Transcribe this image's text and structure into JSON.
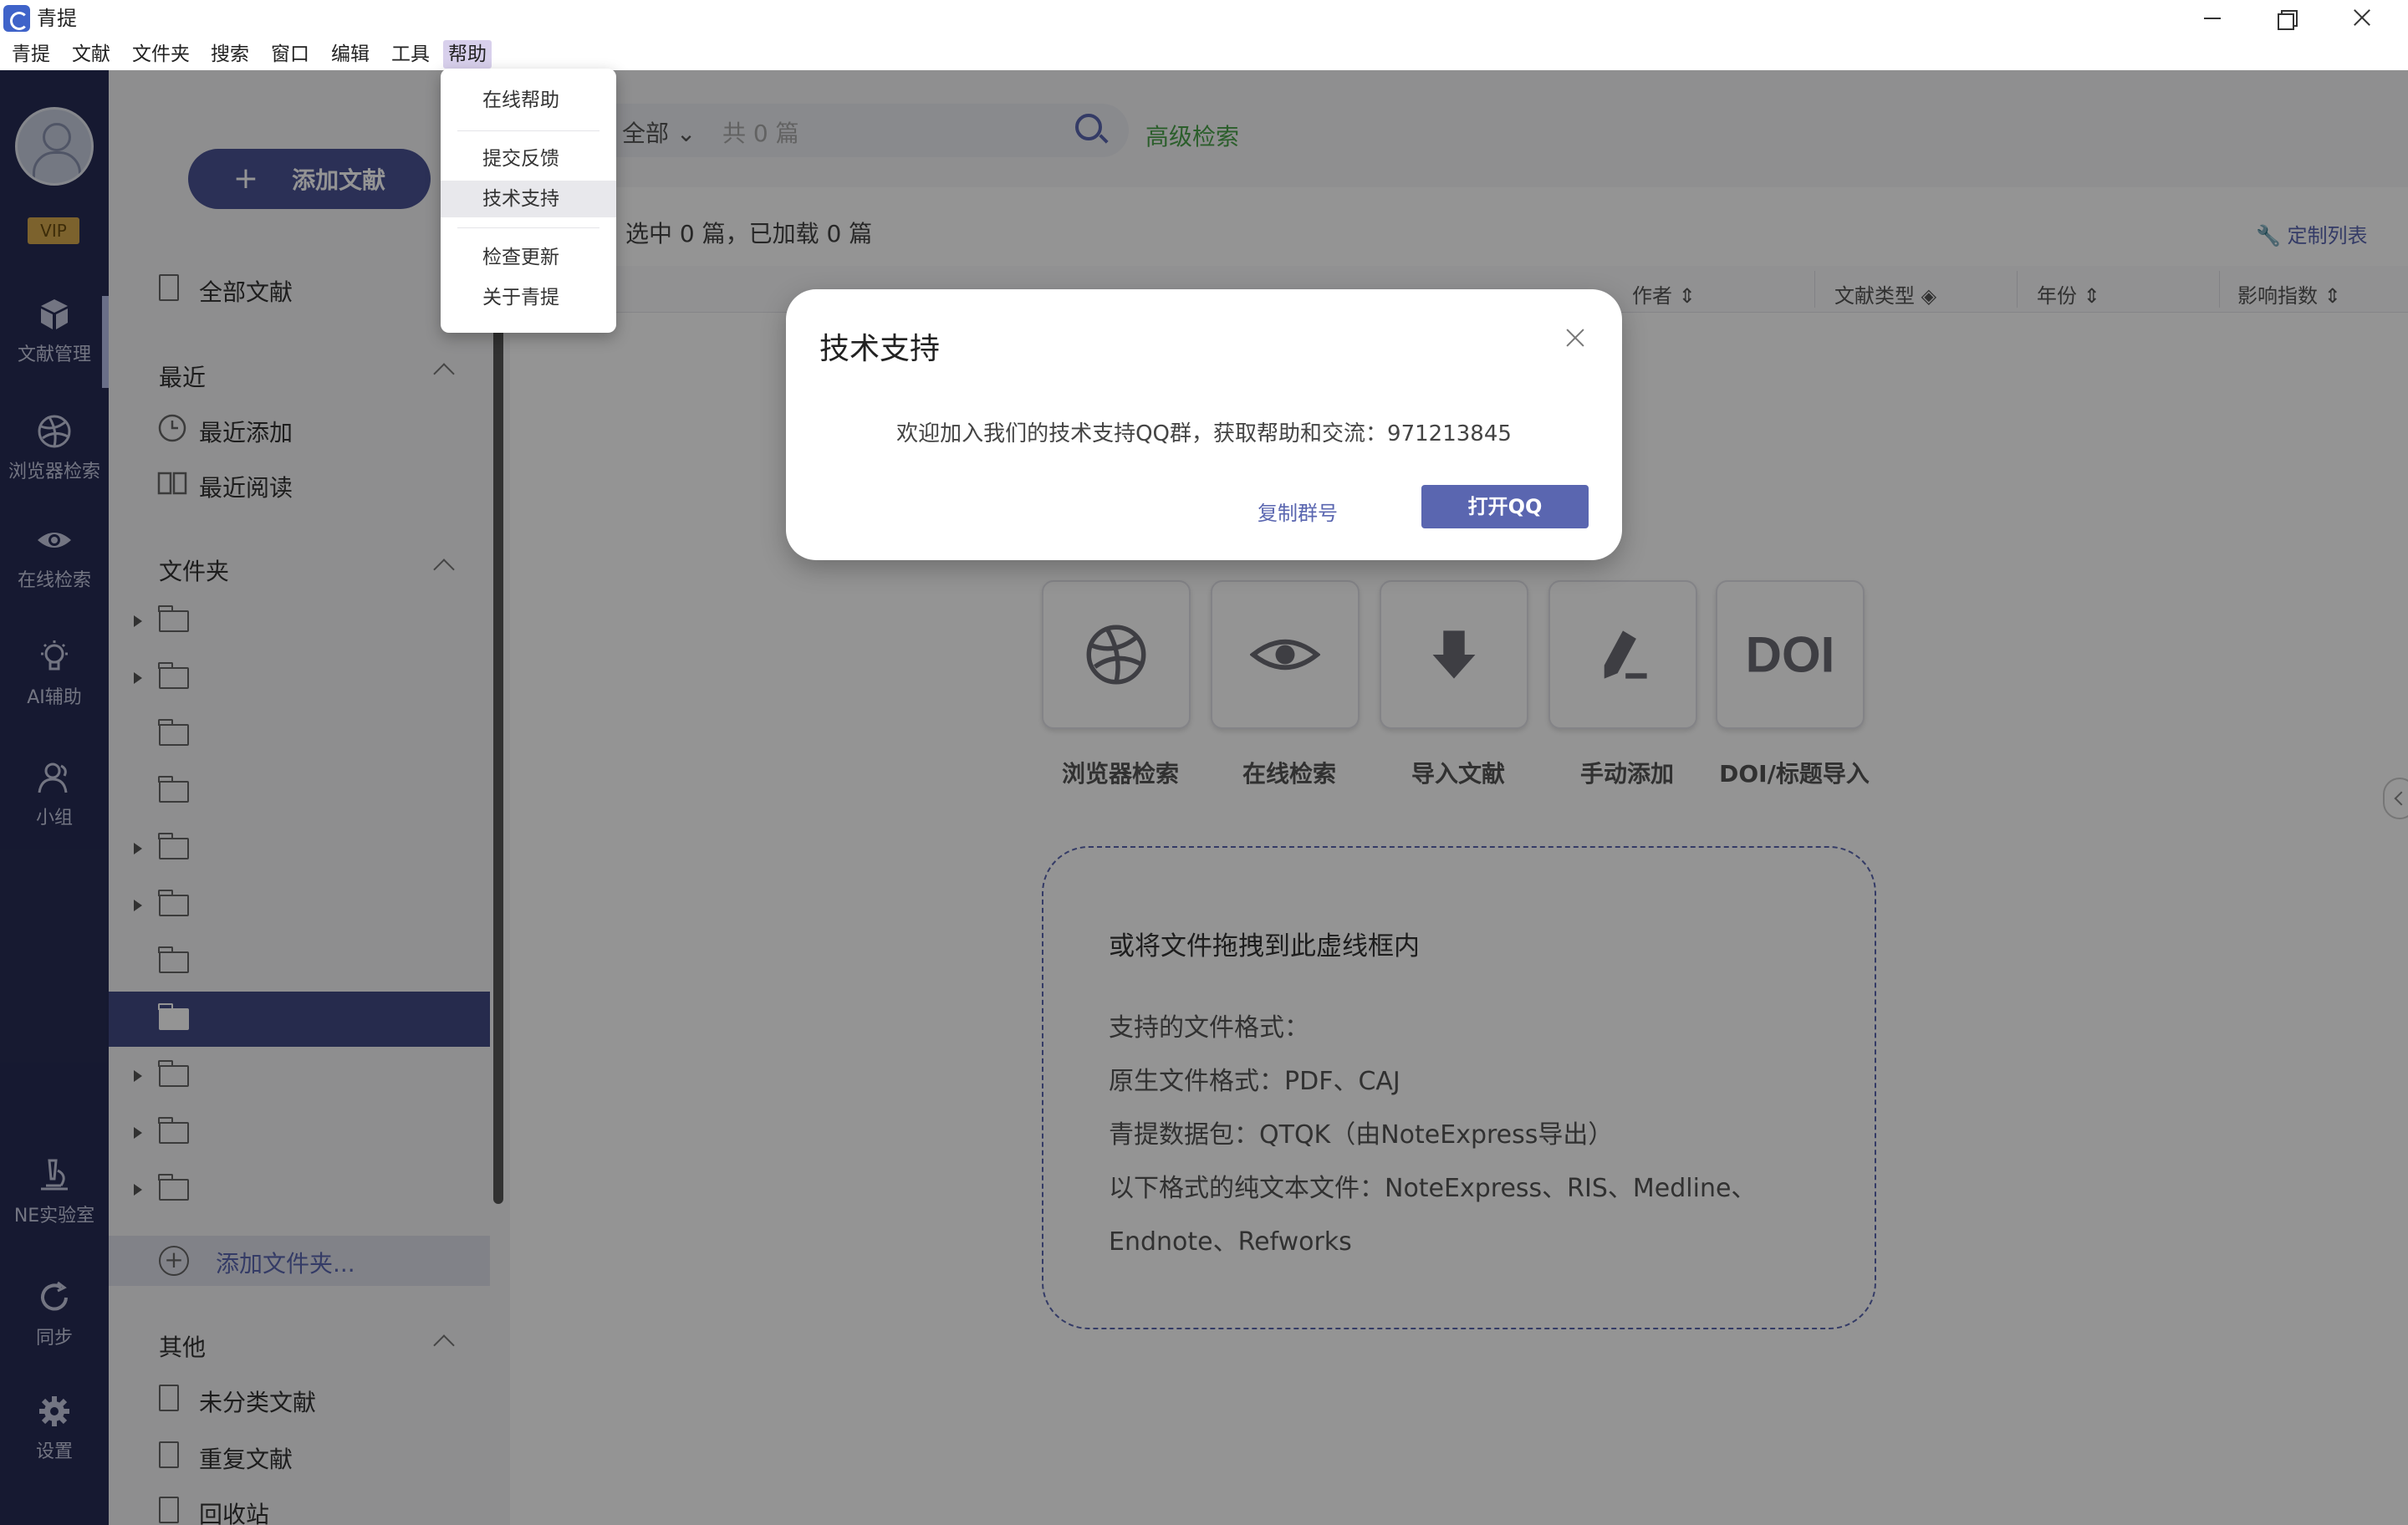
{
  "window": {
    "title": "青提"
  },
  "menubar": {
    "items": [
      {
        "label": "青提"
      },
      {
        "label": "文献"
      },
      {
        "label": "文件夹"
      },
      {
        "label": "搜索"
      },
      {
        "label": "窗口"
      },
      {
        "label": "编辑"
      },
      {
        "label": "工具"
      },
      {
        "label": "帮助"
      }
    ],
    "active": "帮助"
  },
  "rail": {
    "vip": "VIP",
    "items": [
      {
        "label": "文献管理",
        "icon": "cube-icon"
      },
      {
        "label": "浏览器检索",
        "icon": "basketball-icon"
      },
      {
        "label": "在线检索",
        "icon": "eye-icon"
      },
      {
        "label": "AI辅助",
        "icon": "lightbulb-icon"
      },
      {
        "label": "小组",
        "icon": "group-icon"
      },
      {
        "label": "NE实验室",
        "icon": "microscope-icon"
      },
      {
        "label": "同步",
        "icon": "sync-icon"
      },
      {
        "label": "设置",
        "icon": "gear-icon"
      }
    ]
  },
  "sidebar": {
    "add_button": "添加文献",
    "all_docs": "全部文献",
    "recent": {
      "title": "最近",
      "items": [
        "最近添加",
        "最近阅读"
      ]
    },
    "folders": {
      "title": "文件夹",
      "add_label": "添加文件夹..."
    },
    "other": {
      "title": "其他",
      "items": [
        "未分类文献",
        "重复文献",
        "回收站"
      ]
    }
  },
  "main": {
    "search": {
      "scope": "全部",
      "count": "共 0 篇",
      "advanced": "高级检索"
    },
    "selection_info": "选中 0 篇，已加载 0 篇",
    "customize": "定制列表",
    "columns": [
      "作者",
      "文献类型",
      "年份",
      "影响指数"
    ],
    "quick_actions": [
      "浏览器检索",
      "在线检索",
      "导入文献",
      "手动添加",
      "DOI/标题导入"
    ],
    "doi_text": "DOI",
    "drop_zone": {
      "title": "或将文件拖拽到此虚线框内",
      "lines": [
        "支持的文件格式：",
        "原生文件格式：PDF、CAJ",
        "青提数据包：QTQK（由NoteExpress导出）",
        "以下格式的纯文本文件：NoteExpress、RIS、Medline、",
        "Endnote、Refworks"
      ]
    }
  },
  "help_menu": {
    "items": [
      "在线帮助",
      "提交反馈",
      "技术支持",
      "检查更新",
      "关于青提"
    ],
    "hovered": "技术支持"
  },
  "dialog": {
    "title": "技术支持",
    "message": "欢迎加入我们的技术支持QQ群，获取帮助和交流：971213845",
    "copy_label": "复制群号",
    "open_label": "打开QQ"
  },
  "colors": {
    "rail_bg": "#272c55",
    "accent": "#5a66b0",
    "selected_folder": "#434b85",
    "advanced_search": "#4ba34a",
    "vip": "#d6a94e"
  }
}
